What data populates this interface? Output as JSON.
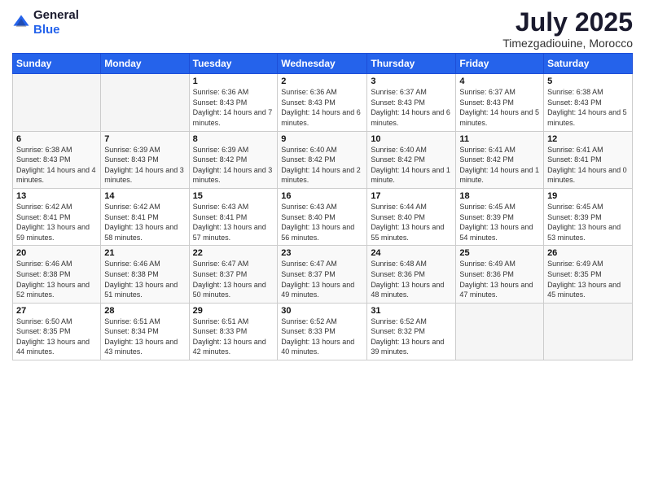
{
  "logo": {
    "general": "General",
    "blue": "Blue"
  },
  "title": "July 2025",
  "subtitle": "Timezgadiouine, Morocco",
  "weekdays": [
    "Sunday",
    "Monday",
    "Tuesday",
    "Wednesday",
    "Thursday",
    "Friday",
    "Saturday"
  ],
  "weeks": [
    [
      {
        "day": "",
        "sunrise": "",
        "sunset": "",
        "daylight": ""
      },
      {
        "day": "",
        "sunrise": "",
        "sunset": "",
        "daylight": ""
      },
      {
        "day": "1",
        "sunrise": "Sunrise: 6:36 AM",
        "sunset": "Sunset: 8:43 PM",
        "daylight": "Daylight: 14 hours and 7 minutes."
      },
      {
        "day": "2",
        "sunrise": "Sunrise: 6:36 AM",
        "sunset": "Sunset: 8:43 PM",
        "daylight": "Daylight: 14 hours and 6 minutes."
      },
      {
        "day": "3",
        "sunrise": "Sunrise: 6:37 AM",
        "sunset": "Sunset: 8:43 PM",
        "daylight": "Daylight: 14 hours and 6 minutes."
      },
      {
        "day": "4",
        "sunrise": "Sunrise: 6:37 AM",
        "sunset": "Sunset: 8:43 PM",
        "daylight": "Daylight: 14 hours and 5 minutes."
      },
      {
        "day": "5",
        "sunrise": "Sunrise: 6:38 AM",
        "sunset": "Sunset: 8:43 PM",
        "daylight": "Daylight: 14 hours and 5 minutes."
      }
    ],
    [
      {
        "day": "6",
        "sunrise": "Sunrise: 6:38 AM",
        "sunset": "Sunset: 8:43 PM",
        "daylight": "Daylight: 14 hours and 4 minutes."
      },
      {
        "day": "7",
        "sunrise": "Sunrise: 6:39 AM",
        "sunset": "Sunset: 8:43 PM",
        "daylight": "Daylight: 14 hours and 3 minutes."
      },
      {
        "day": "8",
        "sunrise": "Sunrise: 6:39 AM",
        "sunset": "Sunset: 8:42 PM",
        "daylight": "Daylight: 14 hours and 3 minutes."
      },
      {
        "day": "9",
        "sunrise": "Sunrise: 6:40 AM",
        "sunset": "Sunset: 8:42 PM",
        "daylight": "Daylight: 14 hours and 2 minutes."
      },
      {
        "day": "10",
        "sunrise": "Sunrise: 6:40 AM",
        "sunset": "Sunset: 8:42 PM",
        "daylight": "Daylight: 14 hours and 1 minute."
      },
      {
        "day": "11",
        "sunrise": "Sunrise: 6:41 AM",
        "sunset": "Sunset: 8:42 PM",
        "daylight": "Daylight: 14 hours and 1 minute."
      },
      {
        "day": "12",
        "sunrise": "Sunrise: 6:41 AM",
        "sunset": "Sunset: 8:41 PM",
        "daylight": "Daylight: 14 hours and 0 minutes."
      }
    ],
    [
      {
        "day": "13",
        "sunrise": "Sunrise: 6:42 AM",
        "sunset": "Sunset: 8:41 PM",
        "daylight": "Daylight: 13 hours and 59 minutes."
      },
      {
        "day": "14",
        "sunrise": "Sunrise: 6:42 AM",
        "sunset": "Sunset: 8:41 PM",
        "daylight": "Daylight: 13 hours and 58 minutes."
      },
      {
        "day": "15",
        "sunrise": "Sunrise: 6:43 AM",
        "sunset": "Sunset: 8:41 PM",
        "daylight": "Daylight: 13 hours and 57 minutes."
      },
      {
        "day": "16",
        "sunrise": "Sunrise: 6:43 AM",
        "sunset": "Sunset: 8:40 PM",
        "daylight": "Daylight: 13 hours and 56 minutes."
      },
      {
        "day": "17",
        "sunrise": "Sunrise: 6:44 AM",
        "sunset": "Sunset: 8:40 PM",
        "daylight": "Daylight: 13 hours and 55 minutes."
      },
      {
        "day": "18",
        "sunrise": "Sunrise: 6:45 AM",
        "sunset": "Sunset: 8:39 PM",
        "daylight": "Daylight: 13 hours and 54 minutes."
      },
      {
        "day": "19",
        "sunrise": "Sunrise: 6:45 AM",
        "sunset": "Sunset: 8:39 PM",
        "daylight": "Daylight: 13 hours and 53 minutes."
      }
    ],
    [
      {
        "day": "20",
        "sunrise": "Sunrise: 6:46 AM",
        "sunset": "Sunset: 8:38 PM",
        "daylight": "Daylight: 13 hours and 52 minutes."
      },
      {
        "day": "21",
        "sunrise": "Sunrise: 6:46 AM",
        "sunset": "Sunset: 8:38 PM",
        "daylight": "Daylight: 13 hours and 51 minutes."
      },
      {
        "day": "22",
        "sunrise": "Sunrise: 6:47 AM",
        "sunset": "Sunset: 8:37 PM",
        "daylight": "Daylight: 13 hours and 50 minutes."
      },
      {
        "day": "23",
        "sunrise": "Sunrise: 6:47 AM",
        "sunset": "Sunset: 8:37 PM",
        "daylight": "Daylight: 13 hours and 49 minutes."
      },
      {
        "day": "24",
        "sunrise": "Sunrise: 6:48 AM",
        "sunset": "Sunset: 8:36 PM",
        "daylight": "Daylight: 13 hours and 48 minutes."
      },
      {
        "day": "25",
        "sunrise": "Sunrise: 6:49 AM",
        "sunset": "Sunset: 8:36 PM",
        "daylight": "Daylight: 13 hours and 47 minutes."
      },
      {
        "day": "26",
        "sunrise": "Sunrise: 6:49 AM",
        "sunset": "Sunset: 8:35 PM",
        "daylight": "Daylight: 13 hours and 45 minutes."
      }
    ],
    [
      {
        "day": "27",
        "sunrise": "Sunrise: 6:50 AM",
        "sunset": "Sunset: 8:35 PM",
        "daylight": "Daylight: 13 hours and 44 minutes."
      },
      {
        "day": "28",
        "sunrise": "Sunrise: 6:51 AM",
        "sunset": "Sunset: 8:34 PM",
        "daylight": "Daylight: 13 hours and 43 minutes."
      },
      {
        "day": "29",
        "sunrise": "Sunrise: 6:51 AM",
        "sunset": "Sunset: 8:33 PM",
        "daylight": "Daylight: 13 hours and 42 minutes."
      },
      {
        "day": "30",
        "sunrise": "Sunrise: 6:52 AM",
        "sunset": "Sunset: 8:33 PM",
        "daylight": "Daylight: 13 hours and 40 minutes."
      },
      {
        "day": "31",
        "sunrise": "Sunrise: 6:52 AM",
        "sunset": "Sunset: 8:32 PM",
        "daylight": "Daylight: 13 hours and 39 minutes."
      },
      {
        "day": "",
        "sunrise": "",
        "sunset": "",
        "daylight": ""
      },
      {
        "day": "",
        "sunrise": "",
        "sunset": "",
        "daylight": ""
      }
    ]
  ]
}
